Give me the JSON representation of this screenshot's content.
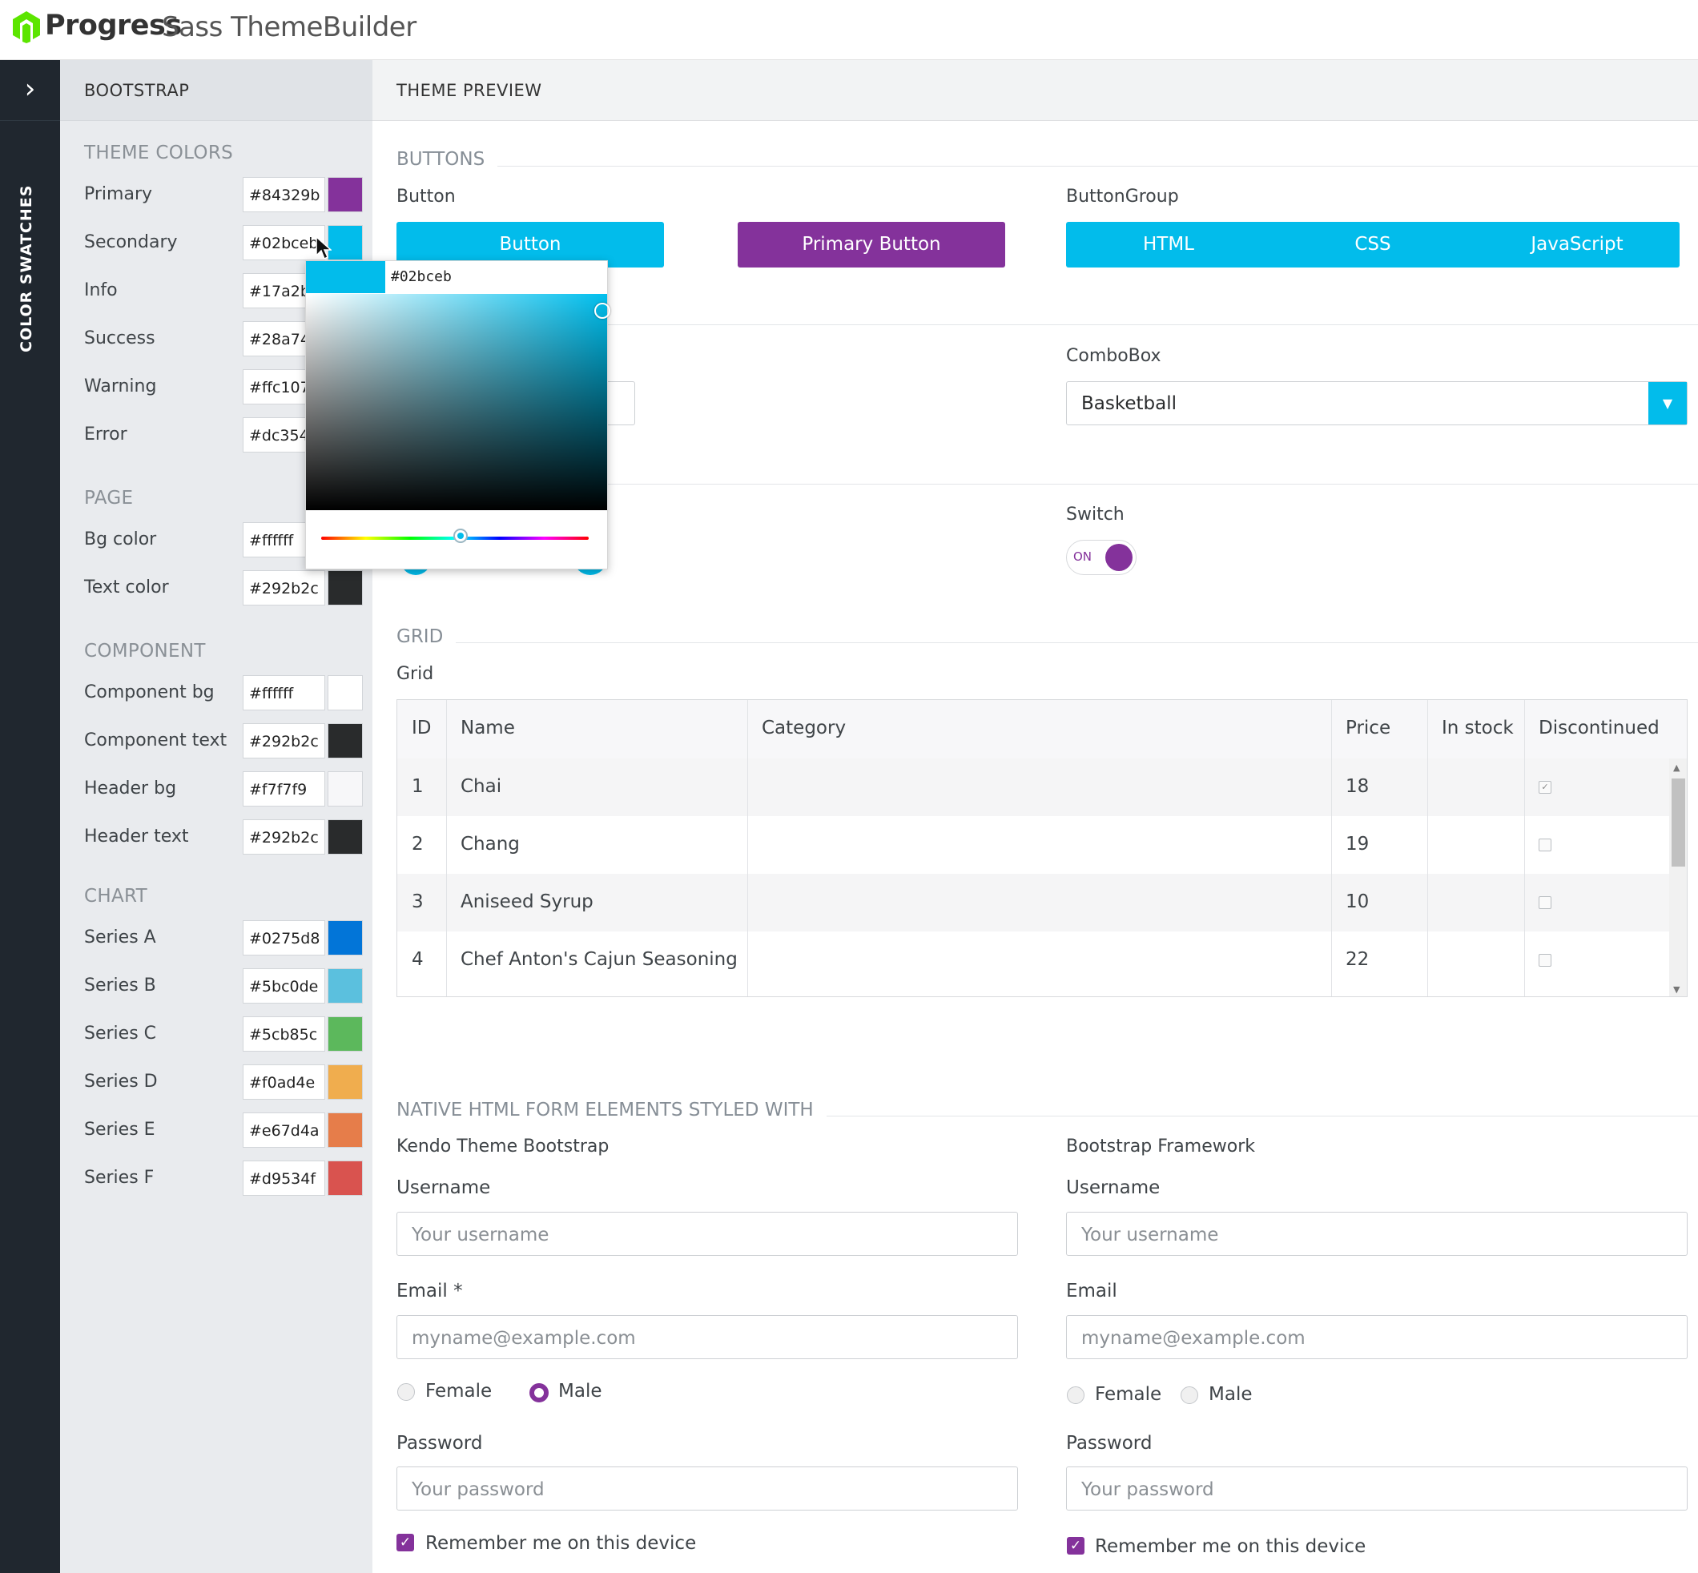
{
  "app": {
    "brand": "Progress",
    "product": "Sass ThemeBuilder",
    "brand_color": "#5ce500"
  },
  "rail": {
    "toggle_icon": "chevron-right-icon",
    "label": "COLOR SWATCHES"
  },
  "sidebar": {
    "title": "BOOTSTRAP",
    "groups": [
      {
        "title": "THEME COLORS",
        "items": [
          {
            "label": "Primary",
            "value": "#84329b"
          },
          {
            "label": "Secondary",
            "value": "#02bceb"
          },
          {
            "label": "Info",
            "value": "#17a2b8"
          },
          {
            "label": "Success",
            "value": "#28a745"
          },
          {
            "label": "Warning",
            "value": "#ffc107"
          },
          {
            "label": "Error",
            "value": "#dc3545"
          }
        ]
      },
      {
        "title": "PAGE",
        "items": [
          {
            "label": "Bg color",
            "value": "#ffffff"
          },
          {
            "label": "Text color",
            "value": "#292b2c"
          }
        ]
      },
      {
        "title": "COMPONENT",
        "items": [
          {
            "label": "Component bg",
            "value": "#ffffff"
          },
          {
            "label": "Component text",
            "value": "#292b2c"
          },
          {
            "label": "Header bg",
            "value": "#f7f7f9"
          },
          {
            "label": "Header text",
            "value": "#292b2c"
          }
        ]
      },
      {
        "title": "CHART",
        "items": [
          {
            "label": "Series A",
            "value": "#0275d8"
          },
          {
            "label": "Series B",
            "value": "#5bc0de"
          },
          {
            "label": "Series C",
            "value": "#5cb85c"
          },
          {
            "label": "Series D",
            "value": "#f0ad4e"
          },
          {
            "label": "Series E",
            "value": "#e67d4a"
          },
          {
            "label": "Series F",
            "value": "#d9534f"
          }
        ]
      }
    ]
  },
  "picker": {
    "value": "#02bceb",
    "hue_color": "#00bfee"
  },
  "main": {
    "title": "THEME PREVIEW",
    "buttons": {
      "section": "BUTTONS",
      "button_caption": "Button",
      "button_label": "Button",
      "primary_label": "Primary Button",
      "group_caption": "ButtonGroup",
      "group": [
        "HTML",
        "CSS",
        "JavaScript"
      ]
    },
    "combobox": {
      "caption": "ComboBox",
      "value": "Basketball",
      "arrow_icon": "caret-down-icon"
    },
    "switch": {
      "caption": "Switch",
      "state_label": "ON"
    },
    "grid": {
      "section": "GRID",
      "caption": "Grid",
      "columns": [
        "ID",
        "Name",
        "Category",
        "Price",
        "In stock",
        "Discontinued"
      ],
      "rows": [
        {
          "id": "1",
          "name": "Chai",
          "category": "",
          "price": "18",
          "in_stock": "",
          "discontinued": true
        },
        {
          "id": "2",
          "name": "Chang",
          "category": "",
          "price": "19",
          "in_stock": "",
          "discontinued": false
        },
        {
          "id": "3",
          "name": "Aniseed Syrup",
          "category": "",
          "price": "10",
          "in_stock": "",
          "discontinued": false
        },
        {
          "id": "4",
          "name": "Chef Anton's Cajun Seasoning",
          "category": "",
          "price": "22",
          "in_stock": "",
          "discontinued": false
        }
      ]
    },
    "forms": {
      "section": "NATIVE HTML FORM ELEMENTS STYLED WITH",
      "kendo": {
        "caption": "Kendo Theme Bootstrap",
        "username_label": "Username",
        "username_placeholder": "Your username",
        "email_label": "Email *",
        "email_placeholder": "myname@example.com",
        "female": "Female",
        "male": "Male",
        "password_label": "Password",
        "password_placeholder": "Your password",
        "remember": "Remember me on this device"
      },
      "bootstrap": {
        "caption": "Bootstrap Framework",
        "username_label": "Username",
        "username_placeholder": "Your username",
        "email_label": "Email",
        "email_placeholder": "myname@example.com",
        "female": "Female",
        "male": "Male",
        "password_label": "Password",
        "password_placeholder": "Your password",
        "remember": "Remember me on this device"
      }
    }
  }
}
